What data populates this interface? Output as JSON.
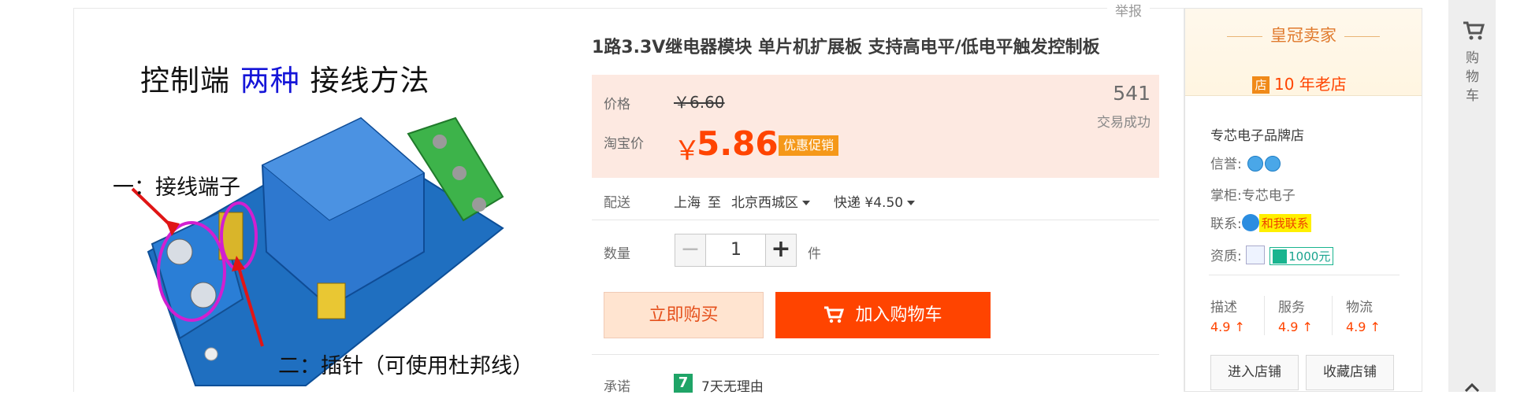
{
  "report_label": "举报",
  "gallery": {
    "title_prefix": "控制端",
    "title_highlight": "两种",
    "title_suffix": "接线方法",
    "label_terminal": "一：接线端子",
    "label_pin": "二：插针（可使用杜邦线）"
  },
  "product": {
    "title": "1路3.3V继电器模块 单片机扩展板 支持高电平/低电平触发控制板",
    "price_label": "价格",
    "original_price": "￥6.60",
    "taobao_price_label": "淘宝价",
    "currency_symbol": "￥",
    "current_price": "5.86",
    "promo_badge": "优惠促销",
    "sales_count": "541",
    "sales_label": "交易成功",
    "delivery_label": "配送",
    "ship_from": "上海",
    "ship_to_word": "至",
    "ship_to": "北京西城区",
    "shipping": "快递 ¥4.50",
    "qty_label": "数量",
    "qty_value": "1",
    "qty_unit": "件",
    "qty_minus": "−",
    "qty_plus": "+",
    "buy_now": "立即购买",
    "add_to_cart": "加入购物车",
    "promise_label": "承诺",
    "promise_icon": "7",
    "promise_text": "7天无理由"
  },
  "shop": {
    "crown_title": "皇冠卖家",
    "store_icon_text": "店",
    "years": "10 年老店",
    "name": "专芯电子品牌店",
    "credit_label": "信誉:",
    "keeper_label": "掌柜:",
    "keeper_name": "专芯电子",
    "contact_label": "联系:",
    "contact_button": "和我联系",
    "qualification_label": "资质:",
    "bond_amount": "1000元",
    "scores": [
      {
        "label": "描述",
        "value": "4.9 ↑"
      },
      {
        "label": "服务",
        "value": "4.9 ↑"
      },
      {
        "label": "物流",
        "value": "4.9 ↑"
      }
    ],
    "enter_shop": "进入店铺",
    "favorite_shop": "收藏店铺"
  },
  "toolbar": {
    "cart_label": "购物车",
    "icon": "cart-icon"
  },
  "colors": {
    "accent": "#ff4400",
    "price_bg": "#fde9e1",
    "promo": "#f59819",
    "crown": "#e07a2d"
  }
}
